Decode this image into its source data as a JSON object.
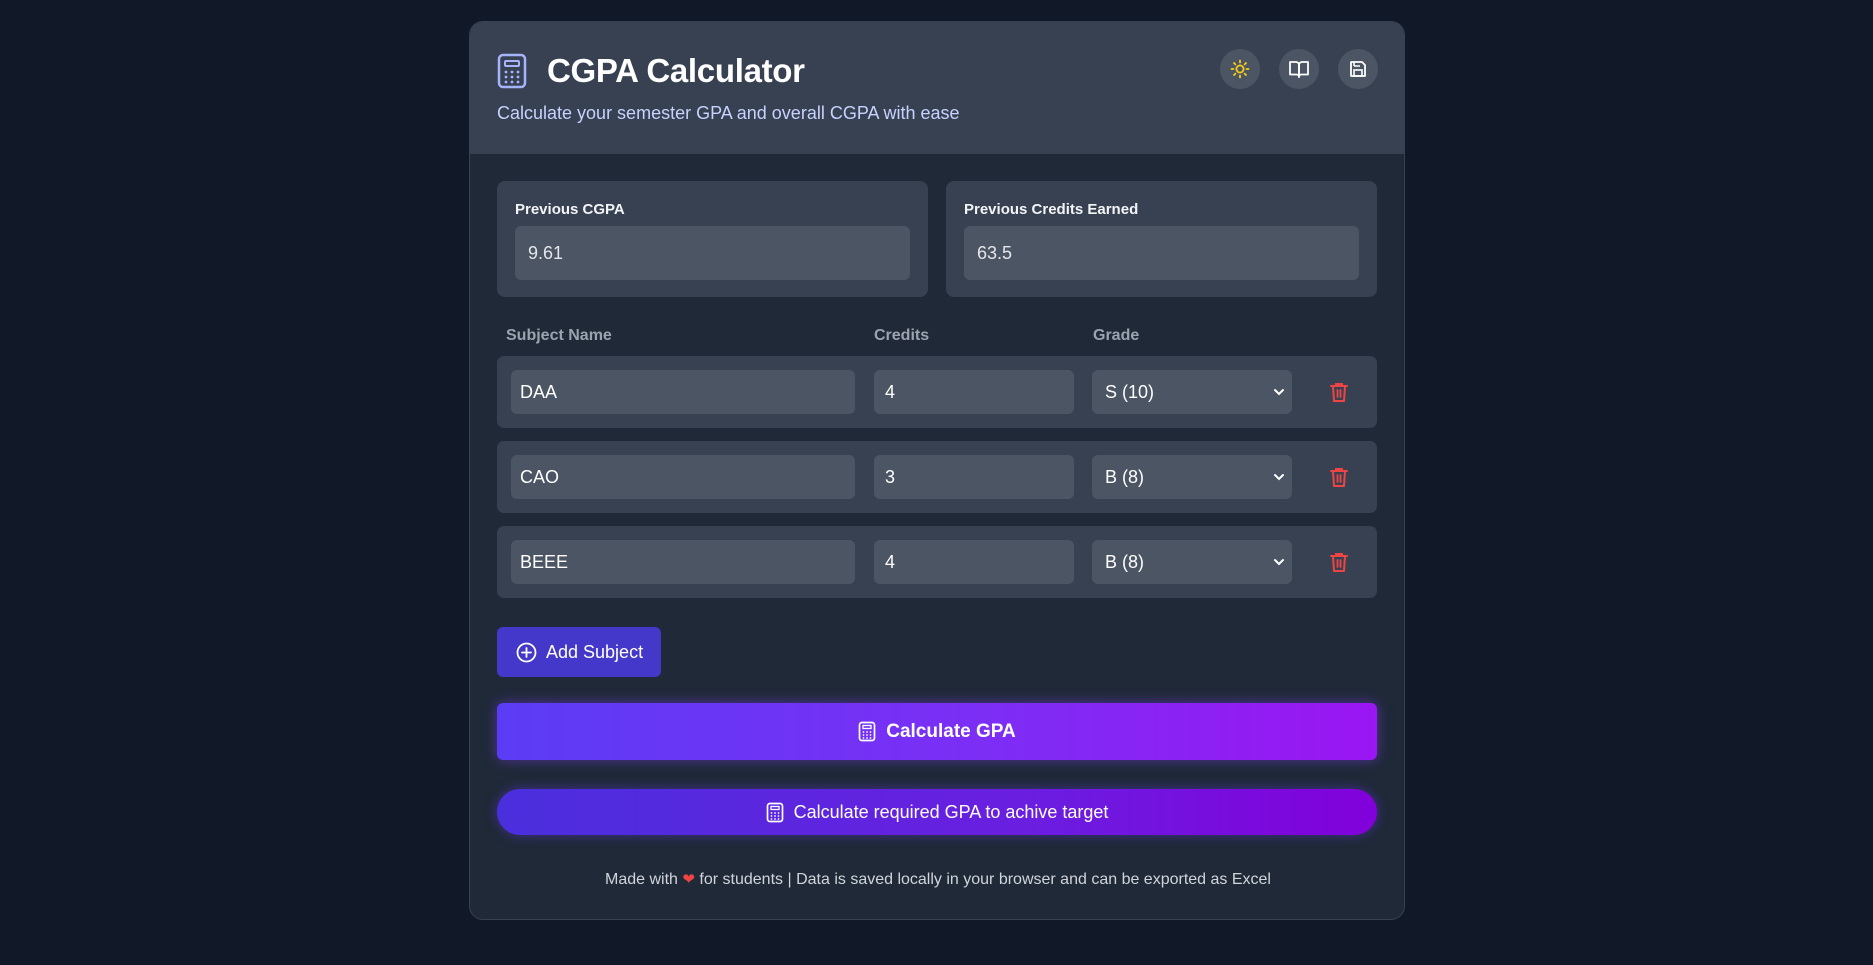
{
  "header": {
    "title": "CGPA Calculator",
    "subtitle": "Calculate your semester GPA and overall CGPA with ease",
    "icons": [
      "calculator-icon",
      "sun-icon",
      "book-open-icon",
      "save-icon"
    ]
  },
  "previous": {
    "cgpa_label": "Previous CGPA",
    "cgpa_value": "9.61",
    "credits_label": "Previous Credits Earned",
    "credits_value": "63.5"
  },
  "subjects_table": {
    "headers": [
      "Subject Name",
      "Credits",
      "Grade"
    ],
    "rows": [
      {
        "name": "DAA",
        "credits": "4",
        "grade": "S (10)"
      },
      {
        "name": "CAO",
        "credits": "3",
        "grade": "B (8)"
      },
      {
        "name": "BEEE",
        "credits": "4",
        "grade": "B (8)"
      }
    ]
  },
  "actions": {
    "add_subject": "Add Subject",
    "calculate_gpa": "Calculate GPA",
    "calculate_target": "Calculate required GPA to achive target"
  },
  "footer": {
    "made_with": "Made with",
    "heart": "❤",
    "rest": "for students | Data is saved locally in your browser and can be exported as Excel"
  },
  "colors": {
    "background": "#111827",
    "card": "#1f2937",
    "header": "#374151",
    "accent": "#4338ca",
    "gradient_start": "#5b3cf5",
    "gradient_end": "#9a16f2",
    "delete": "#ef4444",
    "sun": "#facc15"
  }
}
